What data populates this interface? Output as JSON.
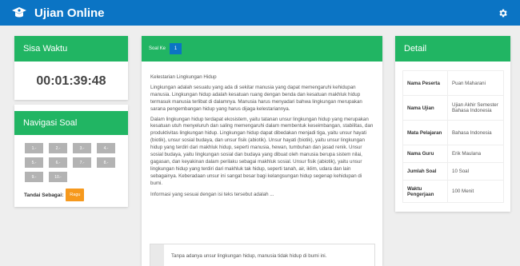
{
  "app": {
    "title": "Ujian Online"
  },
  "timer": {
    "label": "Sisa Waktu",
    "value": "00:01:39:48"
  },
  "navigation": {
    "label": "Navigasi Soal",
    "buttons": [
      "1.-",
      "2.-",
      "3.-",
      "4.-",
      "5.-",
      "6.-",
      "7.-",
      "8.-",
      "9.-",
      "10.-"
    ],
    "mark_label": "Tandai Sebagai:",
    "mark_button": "Ragu"
  },
  "question": {
    "label": "Soal Ke",
    "number": "1",
    "passage_title": "Kelestarian Lingkungan Hidup",
    "paragraph_1": "Lingkungan adalah sesuatu yang ada di sekitar manusia yang dapat memengaruhi kehidupan manusia. Lingkungan hidup adalah kesatuan ruang dengan benda dan kesatuan makhluk hidup termasuk manusia terlibat di dalamnya. Manusia harus menyadari bahwa lingkungan merupakan sarana pengembangan hidup yang harus dijaga kelestariannya.",
    "paragraph_2": "Dalam lingkungan hidup terdapat ekosistem, yaitu tatanan unsur lingkungan hidup yang merupakan kesatuan utuh menyeluruh dan saling memengaruhi dalam membentuk keseimbangan, stabilitas, dan produktivitas lingkungan hidup. Lingkungan hidup dapat dibedakan menjadi tiga, yaitu unsur hayati (biotik), unsur sosial budaya, dan unsur fisik (abiotik). Unsur hayati (biotik), yaitu unsur lingkungan hidup yang terdiri dari makhluk hidup, seperti manusia, hewan, tumbuhan dan jasad renik. Unsur sosial budaya, yaitu lingkungan sosial dan budaya yang dibuat oleh manusia berupa sistem nilai, gagasan, dan keyakinan dalam perilaku sebagai makhluk sosial. Unsur fisik (abiotik), yaitu unsur lingkungan hidup yang terdiri dari makhluk tak hidup, seperti tanah, air, iklim, udara dan lain sebagainya. Keberadaan unsur ini sangat besar bagi kelangsungan hidup segenap kehidupan di bumi.",
    "prompt": "Informasi yang sesuai dengan isi teks tersebut adalah ...",
    "option_letter": "",
    "option_text": "Tanpa adanya unsur lingkungan hidup, manusia tidak hidup di bumi ini."
  },
  "detail": {
    "label": "Detail",
    "rows": [
      {
        "key": "Nama Peserta",
        "value": "Puan Maharani"
      },
      {
        "key": "Nama Ujian",
        "value": "Ujian Akhir Semester Bahasa Indonesia"
      },
      {
        "key": "Mata Pelajaran",
        "value": "Bahasa Indonesia"
      },
      {
        "key": "Nama Guru",
        "value": "Erik Maulana"
      },
      {
        "key": "Jumlah Soal",
        "value": "10 Soal"
      },
      {
        "key": "Waktu Pengerjaan",
        "value": "100 Menit"
      }
    ]
  },
  "colors": {
    "topbar": "#0b74c4",
    "header": "#21b563",
    "ragu": "#f6991d",
    "nav_button": "#b3b3b3"
  },
  "icons": {
    "logo": "graduation-logo-icon",
    "settings": "gear-icon"
  }
}
